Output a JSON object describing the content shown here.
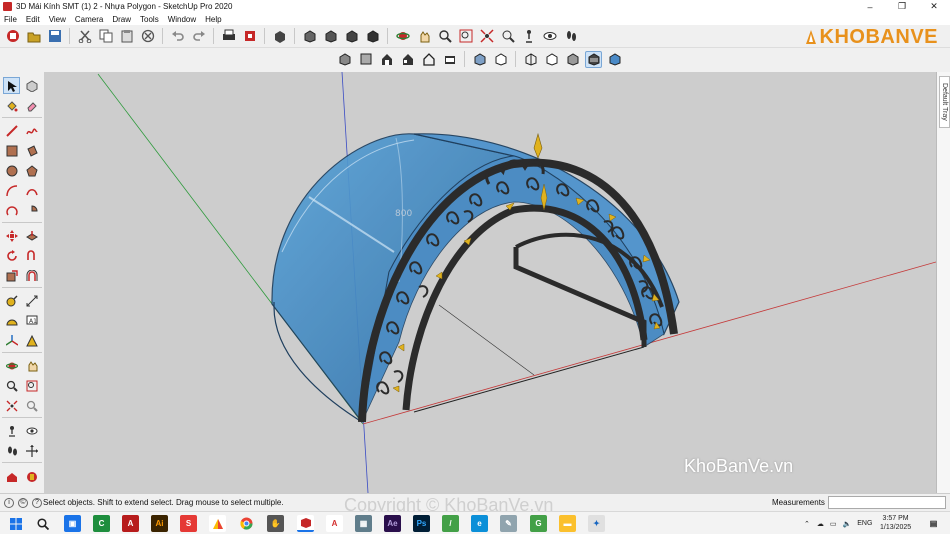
{
  "window": {
    "title": "3D Mái Kính SMT (1) 2 - Nhựa Polygon - SketchUp Pro 2020",
    "controls": [
      "–",
      "❐",
      "✕"
    ]
  },
  "menu": [
    "File",
    "Edit",
    "View",
    "Camera",
    "Draw",
    "Tools",
    "Window",
    "Help"
  ],
  "brand": {
    "logo_text": "KHOBANVE",
    "accent": "#e8911c"
  },
  "tray": {
    "label": "Default Tray"
  },
  "viewport": {
    "dimension_label": "800",
    "colors": {
      "background": "#cdcdcd",
      "glass": "#3f86c2",
      "frame": "#2b2b2b",
      "ornament_leaf": "#e0b21e"
    }
  },
  "status": {
    "text": "Select objects. Shift to extend select. Drag mouse to select multiple.",
    "measurements_label": "Measurements",
    "measurements_value": ""
  },
  "watermarks": {
    "viewport": "KhoBanVe.vn",
    "bottom": "Copyright © KhoBanVe.vn"
  },
  "taskbar": {
    "lang": "ENG",
    "time": "3:57 PM",
    "date": "1/13/2025",
    "apps": [
      "windows-start",
      "search",
      "photos",
      "excel-like",
      "autocad",
      "illustrator",
      "swift",
      "chrome",
      "spreadsheet",
      "chrome2",
      "hand-tool",
      "sketchup",
      "acrobat",
      "files",
      "after-effects",
      "photoshop",
      "pen",
      "edge",
      "pen2",
      "acrobat2",
      "explorer",
      "sketch"
    ]
  }
}
